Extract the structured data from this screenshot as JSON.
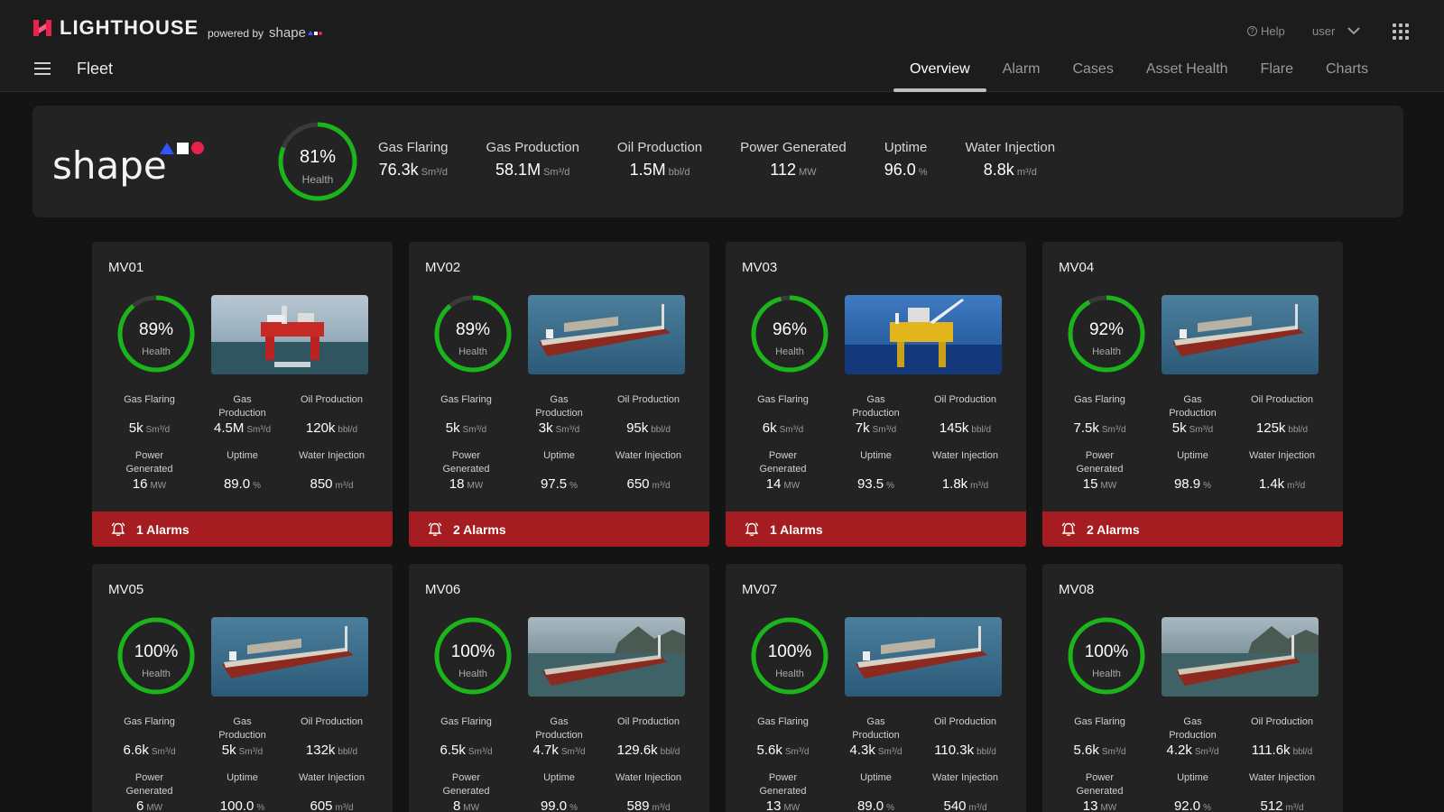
{
  "header": {
    "brand": "LIGHTHOUSE",
    "powered_by": "powered by",
    "powered_brand": "shape",
    "help": "Help",
    "user": "user",
    "section": "Fleet",
    "tabs": [
      {
        "label": "Overview",
        "active": true
      },
      {
        "label": "Alarm",
        "active": false
      },
      {
        "label": "Cases",
        "active": false
      },
      {
        "label": "Asset Health",
        "active": false
      },
      {
        "label": "Flare",
        "active": false
      },
      {
        "label": "Charts",
        "active": false
      }
    ]
  },
  "summary": {
    "logo": "shape",
    "health": {
      "value": "81%",
      "label": "Health",
      "fraction": 0.81
    },
    "kpis": [
      {
        "label": "Gas Flaring",
        "value": "76.3k",
        "unit": "Sm³/d"
      },
      {
        "label": "Gas Production",
        "value": "58.1M",
        "unit": "Sm³/d"
      },
      {
        "label": "Oil Production",
        "value": "1.5M",
        "unit": "bbl/d"
      },
      {
        "label": "Power Generated",
        "value": "112",
        "unit": "MW"
      },
      {
        "label": "Uptime",
        "value": "96.0",
        "unit": "%"
      },
      {
        "label": "Water Injection",
        "value": "8.8k",
        "unit": "m³/d"
      }
    ]
  },
  "metric_labels": {
    "gas_flaring": "Gas Flaring",
    "gas_production": "Gas Production",
    "oil_production": "Oil Production",
    "power_generated": "Power Generated",
    "uptime": "Uptime",
    "water_injection": "Water Injection"
  },
  "units": {
    "sm3d": "Sm³/d",
    "bbld": "bbl/d",
    "mw": "MW",
    "pct": "%",
    "m3d": "m³/d"
  },
  "health_label": "Health",
  "colors": {
    "gauge": "#1bb51b",
    "alarm": "#a51d20",
    "accent_blue": "#2f55ff",
    "accent_red": "#e8224e"
  },
  "assets": [
    {
      "name": "MV01",
      "health": "89%",
      "health_frac": 0.89,
      "image": "rig-red",
      "gas_flaring": "5k",
      "gas_production": "4.5M",
      "oil_production": "120k",
      "power_generated": "16",
      "uptime": "89.0",
      "water_injection": "850",
      "alarms": "1 Alarms"
    },
    {
      "name": "MV02",
      "health": "89%",
      "health_frac": 0.89,
      "image": "fpso",
      "gas_flaring": "5k",
      "gas_production": "3k",
      "oil_production": "95k",
      "power_generated": "18",
      "uptime": "97.5",
      "water_injection": "650",
      "alarms": "2 Alarms"
    },
    {
      "name": "MV03",
      "health": "96%",
      "health_frac": 0.96,
      "image": "platform-yellow",
      "gas_flaring": "6k",
      "gas_production": "7k",
      "oil_production": "145k",
      "power_generated": "14",
      "uptime": "93.5",
      "water_injection": "1.8k",
      "alarms": "1 Alarms"
    },
    {
      "name": "MV04",
      "health": "92%",
      "health_frac": 0.92,
      "image": "fpso",
      "gas_flaring": "7.5k",
      "gas_production": "5k",
      "oil_production": "125k",
      "power_generated": "15",
      "uptime": "98.9",
      "water_injection": "1.4k",
      "alarms": "2 Alarms"
    },
    {
      "name": "MV05",
      "health": "100%",
      "health_frac": 1.0,
      "image": "fpso",
      "gas_flaring": "6.6k",
      "gas_production": "5k",
      "oil_production": "132k",
      "power_generated": "6",
      "uptime": "100.0",
      "water_injection": "605",
      "alarms": ""
    },
    {
      "name": "MV06",
      "health": "100%",
      "health_frac": 1.0,
      "image": "fpso-coast",
      "gas_flaring": "6.5k",
      "gas_production": "4.7k",
      "oil_production": "129.6k",
      "power_generated": "8",
      "uptime": "99.0",
      "water_injection": "589",
      "alarms": ""
    },
    {
      "name": "MV07",
      "health": "100%",
      "health_frac": 1.0,
      "image": "fpso",
      "gas_flaring": "5.6k",
      "gas_production": "4.3k",
      "oil_production": "110.3k",
      "power_generated": "13",
      "uptime": "89.0",
      "water_injection": "540",
      "alarms": ""
    },
    {
      "name": "MV08",
      "health": "100%",
      "health_frac": 1.0,
      "image": "fpso-coast",
      "gas_flaring": "5.6k",
      "gas_production": "4.2k",
      "oil_production": "111.6k",
      "power_generated": "13",
      "uptime": "92.0",
      "water_injection": "512",
      "alarms": ""
    }
  ]
}
